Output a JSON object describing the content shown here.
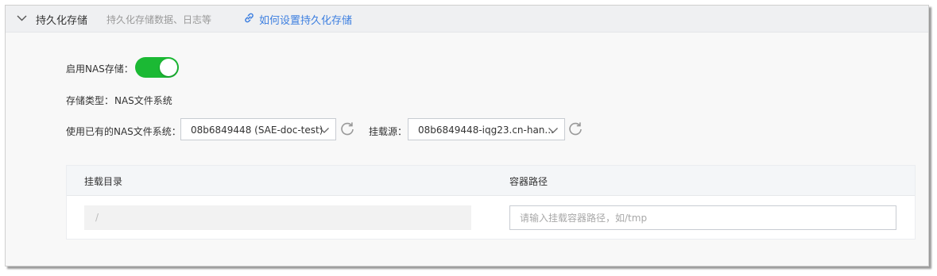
{
  "header": {
    "title": "持久化存储",
    "subtitle": "持久化存储数据、日志等",
    "help_link": "如何设置持久化存储"
  },
  "nas_enable": {
    "label": "启用NAS存储：",
    "enabled": true
  },
  "storage_type": {
    "label": "存储类型：",
    "value": "NAS文件系统"
  },
  "filesystem": {
    "label": "使用已有的NAS文件系统：",
    "selected": "08b6849448 (SAE-doc-test)"
  },
  "mount_source": {
    "label": "挂载源：",
    "selected": "08b6849448-iqg23.cn-han..."
  },
  "table": {
    "columns": [
      "挂载目录",
      "容器路径"
    ],
    "rows": [
      {
        "mount_dir": "/",
        "container_path": "",
        "container_path_placeholder": "请输入挂载容器路径，如/tmp"
      }
    ]
  },
  "colors": {
    "accent": "#3d7fe0",
    "toggle_on": "#1bb934"
  }
}
